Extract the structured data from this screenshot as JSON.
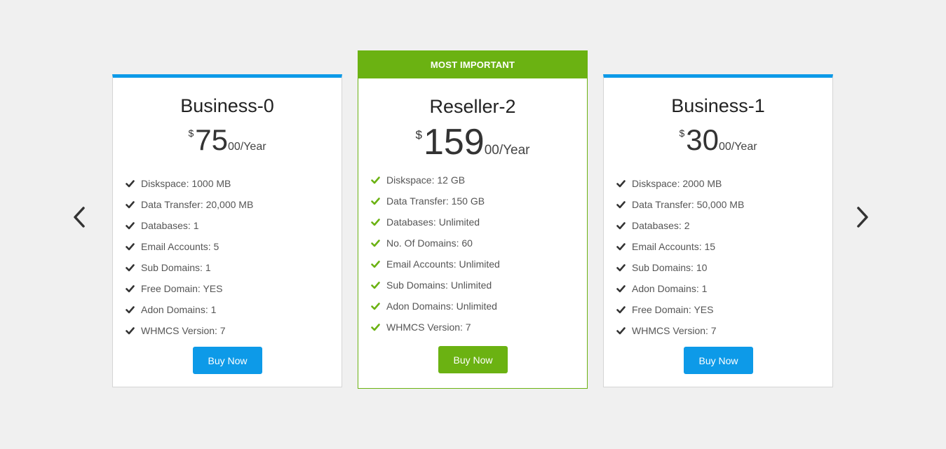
{
  "colors": {
    "accent_blue": "#0d9ae8",
    "accent_green": "#6bb212",
    "background": "#f0f0f0"
  },
  "navigation": {
    "prev_icon": "chevron-left-icon",
    "next_icon": "chevron-right-icon"
  },
  "plans": [
    {
      "name": "Business-0",
      "currency": "$",
      "amount": "75",
      "cents_period": "00/Year",
      "button_label": "Buy Now",
      "features": [
        "Diskspace: 1000 MB",
        "Data Transfer: 20,000 MB",
        "Databases: 1",
        "Email Accounts: 5",
        "Sub Domains: 1",
        "Free Domain: YES",
        "Adon Domains: 1",
        "WHMCS Version: 7"
      ]
    },
    {
      "ribbon": "MOST IMPORTANT",
      "name": "Reseller-2",
      "currency": "$",
      "amount": "159",
      "cents_period": "00/Year",
      "button_label": "Buy Now",
      "features": [
        "Diskspace: 12 GB",
        "Data Transfer: 150 GB",
        "Databases: Unlimited",
        "No. Of Domains: 60",
        "Email Accounts: Unlimited",
        "Sub Domains: Unlimited",
        "Adon Domains: Unlimited",
        "WHMCS Version: 7"
      ]
    },
    {
      "name": "Business-1",
      "currency": "$",
      "amount": "30",
      "cents_period": "00/Year",
      "button_label": "Buy Now",
      "features": [
        "Diskspace: 2000 MB",
        "Data Transfer: 50,000 MB",
        "Databases: 2",
        "Email Accounts: 15",
        "Sub Domains: 10",
        "Adon Domains: 1",
        "Free Domain: YES",
        "WHMCS Version: 7"
      ]
    }
  ]
}
